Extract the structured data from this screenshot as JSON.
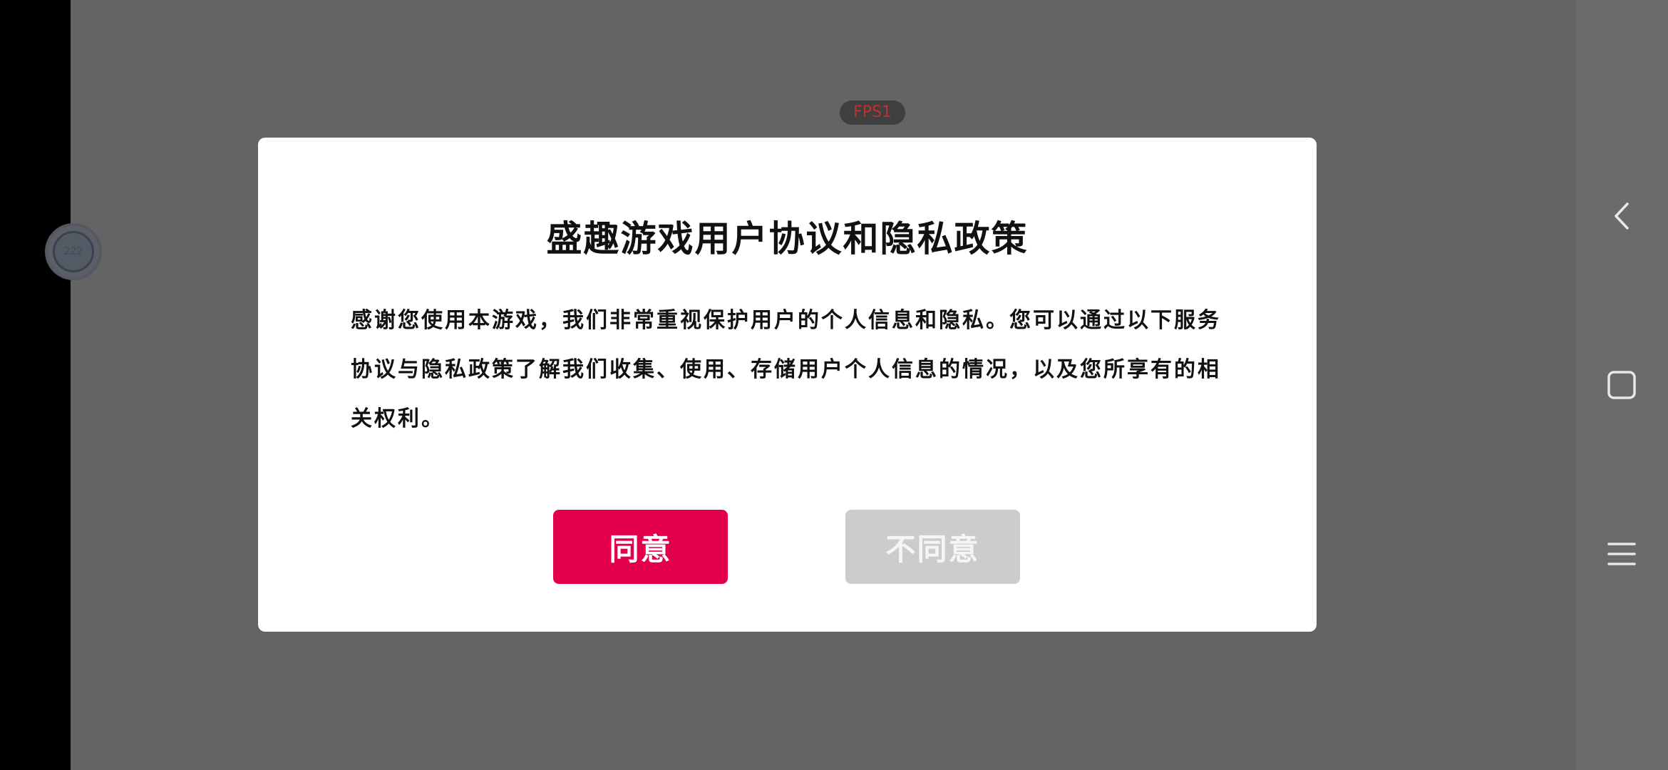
{
  "overlay": {
    "fps_label": "FPS1",
    "float_ball_label": "222"
  },
  "dialog": {
    "title": "盛趣游戏用户协议和隐私政策",
    "body": "感谢您使用本游戏，我们非常重视保护用户的个人信息和隐私。您可以通过以下服务协议与隐私政策了解我们收集、使用、存储用户个人信息的情况，以及您所享有的相关权利。",
    "agree_label": "同意",
    "disagree_label": "不同意"
  },
  "colors": {
    "agree_button": "#e2004b",
    "disagree_button": "#cccccc",
    "backdrop": "#646464"
  },
  "navbar": {
    "icons": [
      "back-icon",
      "home-icon",
      "menu-icon"
    ]
  }
}
